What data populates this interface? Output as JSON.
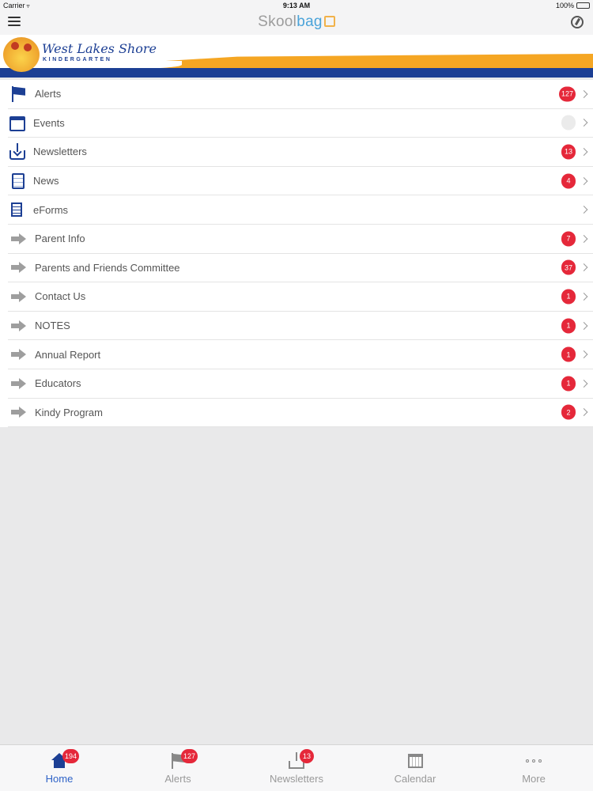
{
  "status_bar": {
    "carrier": "Carrier",
    "time": "9:13 AM",
    "battery": "100%"
  },
  "nav": {
    "logo_part1": "Skool",
    "logo_part2": "bag"
  },
  "banner": {
    "school_name": "West Lakes Shore",
    "school_sub": "KINDERGARTEN"
  },
  "colors": {
    "badge": "#e5283a",
    "accent_blue": "#1c3f94",
    "tab_active": "#2e62c7",
    "banner_orange": "#f5a623"
  },
  "menu": [
    {
      "label": "Alerts",
      "icon": "flag-icon",
      "badge": "127"
    },
    {
      "label": "Events",
      "icon": "calendar-icon",
      "badge": ""
    },
    {
      "label": "Newsletters",
      "icon": "inbox-icon",
      "badge": "13"
    },
    {
      "label": "News",
      "icon": "document-icon",
      "badge": "4"
    },
    {
      "label": "eForms",
      "icon": "form-icon",
      "badge": null
    },
    {
      "label": "Parent Info",
      "icon": "arrow-right-icon",
      "badge": "7"
    },
    {
      "label": "Parents and Friends Committee",
      "icon": "arrow-right-icon",
      "badge": "37"
    },
    {
      "label": "Contact Us",
      "icon": "arrow-right-icon",
      "badge": "1"
    },
    {
      "label": "NOTES",
      "icon": "arrow-right-icon",
      "badge": "1"
    },
    {
      "label": "Annual Report",
      "icon": "arrow-right-icon",
      "badge": "1"
    },
    {
      "label": "Educators",
      "icon": "arrow-right-icon",
      "badge": "1"
    },
    {
      "label": "Kindy Program",
      "icon": "arrow-right-icon",
      "badge": "2"
    }
  ],
  "tabs": [
    {
      "label": "Home",
      "icon": "home-icon",
      "badge": "194",
      "active": true
    },
    {
      "label": "Alerts",
      "icon": "flag-icon",
      "badge": "127",
      "active": false
    },
    {
      "label": "Newsletters",
      "icon": "inbox-icon",
      "badge": "13",
      "active": false
    },
    {
      "label": "Calendar",
      "icon": "calendar-icon",
      "badge": null,
      "active": false
    },
    {
      "label": "More",
      "icon": "more-icon",
      "badge": null,
      "active": false
    }
  ]
}
